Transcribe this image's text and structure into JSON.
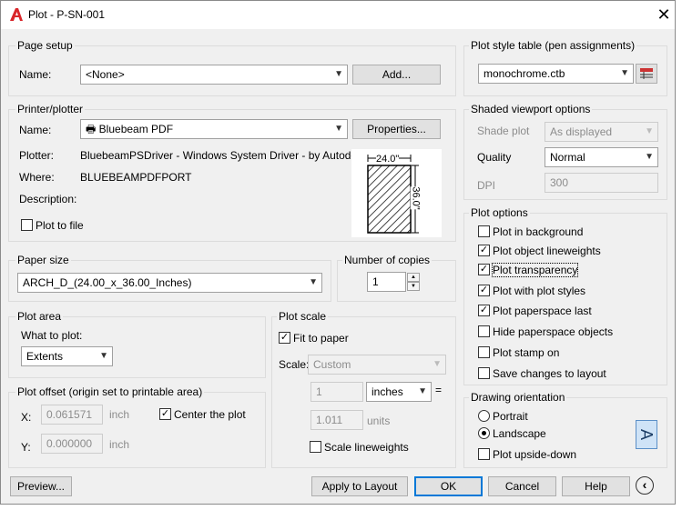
{
  "window": {
    "title": "Plot - P-SN-001",
    "close": "✕"
  },
  "page_setup": {
    "group": "Page setup",
    "name_label": "Name:",
    "name_value": "<None>",
    "add_button": "Add..."
  },
  "printer": {
    "group": "Printer/plotter",
    "name_label": "Name:",
    "name_value": "Bluebeam PDF",
    "properties_button": "Properties...",
    "plotter_label": "Plotter:",
    "plotter_value": "BluebeamPSDriver - Windows System Driver - by Autodesk",
    "where_label": "Where:",
    "where_value": "BLUEBEAMPDFPORT",
    "description_label": "Description:",
    "plot_to_file": "Plot to file",
    "preview_width": "24.0\"",
    "preview_height": "36.0\""
  },
  "paper_size": {
    "group": "Paper size",
    "value": "ARCH_D_(24.00_x_36.00_Inches)"
  },
  "copies": {
    "group": "Number of copies",
    "value": "1"
  },
  "plot_area": {
    "group": "Plot area",
    "what_label": "What to plot:",
    "what_value": "Extents"
  },
  "plot_offset": {
    "group": "Plot offset (origin set to printable area)",
    "x_label": "X:",
    "x_value": "0.061571",
    "x_unit": "inch",
    "y_label": "Y:",
    "y_value": "0.000000",
    "y_unit": "inch",
    "center": "Center the plot"
  },
  "plot_scale": {
    "group": "Plot scale",
    "fit": "Fit to paper",
    "scale_label": "Scale:",
    "scale_value": "Custom",
    "num": "1",
    "unit": "inches",
    "equals": "=",
    "units_value": "1.011",
    "units_label": "units",
    "scale_lw": "Scale lineweights"
  },
  "style_table": {
    "group": "Plot style table (pen assignments)",
    "value": "monochrome.ctb"
  },
  "shaded": {
    "group": "Shaded viewport options",
    "shade_label": "Shade plot",
    "shade_value": "As displayed",
    "quality_label": "Quality",
    "quality_value": "Normal",
    "dpi_label": "DPI",
    "dpi_value": "300"
  },
  "plot_options": {
    "group": "Plot options",
    "items": [
      {
        "label": "Plot in background",
        "checked": ""
      },
      {
        "label": "Plot object lineweights",
        "checked": "✓"
      },
      {
        "label": "Plot transparency",
        "checked": "✓"
      },
      {
        "label": "Plot with plot styles",
        "checked": "✓"
      },
      {
        "label": "Plot paperspace last",
        "checked": "✓"
      },
      {
        "label": "Hide paperspace objects",
        "checked": ""
      },
      {
        "label": "Plot stamp on",
        "checked": ""
      },
      {
        "label": "Save changes to layout",
        "checked": ""
      }
    ]
  },
  "orientation": {
    "group": "Drawing orientation",
    "portrait": "Portrait",
    "landscape": "Landscape",
    "upside": "Plot upside-down",
    "icon": "A"
  },
  "footer": {
    "preview": "Preview...",
    "apply": "Apply to Layout",
    "ok": "OK",
    "cancel": "Cancel",
    "help": "Help"
  },
  "colors": {
    "accent": "#0078d7",
    "logo": "#d9262a"
  }
}
